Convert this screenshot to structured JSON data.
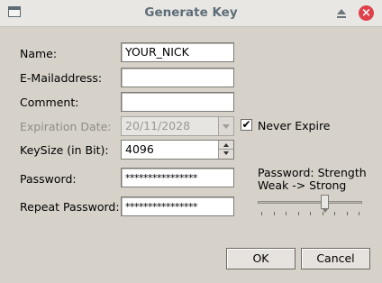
{
  "window": {
    "title": "Generate Key",
    "icons": [
      "window-icon",
      "maximize-icon",
      "close-icon"
    ],
    "close_glyph": "×"
  },
  "form": {
    "name_label": "Name:",
    "name_value": "YOUR_NICK",
    "email_label": "E-Mailaddress:",
    "email_value": "",
    "comment_label": "Comment:",
    "comment_value": "",
    "expiration_label": "Expiration Date:",
    "expiration_value": "20/11/2028",
    "never_expire_label": "Never Expire",
    "never_expire_checked": true,
    "never_expire_glyph": "✔",
    "keysize_label": "KeySize (in Bit):",
    "keysize_value": "4096",
    "password_label": "Password:",
    "password_value": "****************",
    "repeat_label": "Repeat Password:",
    "repeat_value": "****************"
  },
  "strength": {
    "label_line1": "Password: Strength",
    "label_line2": "Weak -> Strong",
    "level_fraction": 0.65,
    "tick_count": 9
  },
  "buttons": {
    "ok": "OK",
    "cancel": "Cancel"
  },
  "colors": {
    "background": "#d6d2ca",
    "title_text": "#5d6d77",
    "close_button": "#e0404a"
  }
}
